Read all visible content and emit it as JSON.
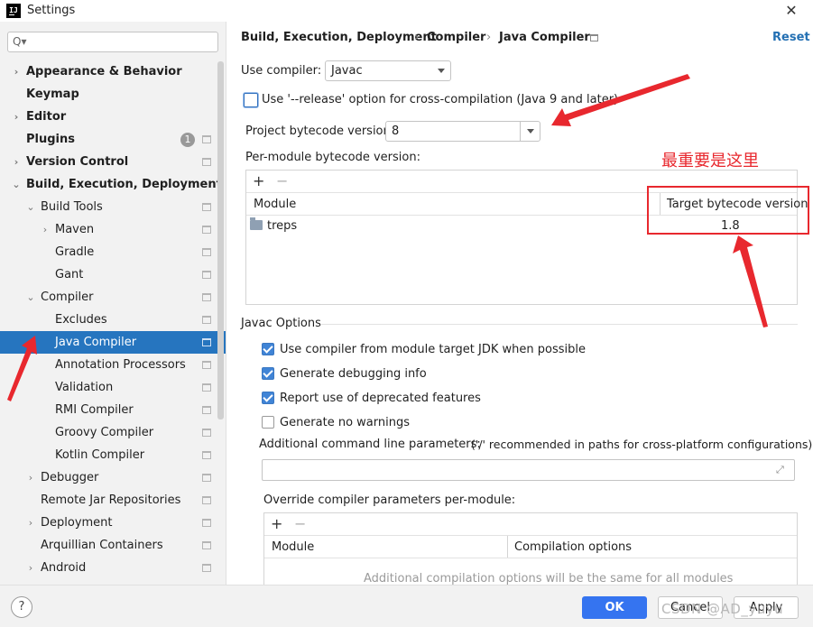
{
  "window": {
    "title": "Settings",
    "app_icon_text": "IJ",
    "close_glyph": "✕"
  },
  "sidebar": {
    "search_placeholder": "",
    "search_glyph": "Q▾",
    "items": [
      {
        "label": "Appearance & Behavior",
        "bold": true,
        "chevron": "›"
      },
      {
        "label": "Keymap",
        "bold": true
      },
      {
        "label": "Editor",
        "bold": true,
        "chevron": "›"
      },
      {
        "label": "Plugins",
        "bold": true,
        "badge": "1"
      },
      {
        "label": "Version Control",
        "bold": true,
        "chevron": "›"
      },
      {
        "label": "Build, Execution, Deployment",
        "bold": true,
        "chevron": "⌄"
      },
      {
        "label": "Build Tools",
        "chevron": "⌄"
      },
      {
        "label": "Maven",
        "chevron": "›"
      },
      {
        "label": "Gradle"
      },
      {
        "label": "Gant"
      },
      {
        "label": "Compiler",
        "chevron": "⌄"
      },
      {
        "label": "Excludes"
      },
      {
        "label": "Java Compiler",
        "selected": true
      },
      {
        "label": "Annotation Processors"
      },
      {
        "label": "Validation"
      },
      {
        "label": "RMI Compiler"
      },
      {
        "label": "Groovy Compiler"
      },
      {
        "label": "Kotlin Compiler"
      },
      {
        "label": "Debugger",
        "chevron": "›"
      },
      {
        "label": "Remote Jar Repositories"
      },
      {
        "label": "Deployment",
        "chevron": "›"
      },
      {
        "label": "Arquillian Containers"
      },
      {
        "label": "Android",
        "chevron": "›"
      }
    ]
  },
  "breadcrumb": {
    "items": [
      "Build, Execution, Deployment",
      "Compiler",
      "Java Compiler"
    ],
    "separator": "›",
    "reset_label": "Reset"
  },
  "main": {
    "use_compiler_label": "Use compiler:",
    "use_compiler_value": "Javac",
    "release_option_label": "Use '--release' option for cross-compilation (Java 9 and later)",
    "release_option_checked": false,
    "project_bytecode_label": "Project bytecode version:",
    "project_bytecode_value": "8",
    "per_module_label": "Per-module bytecode version:",
    "module_table": {
      "add": "+",
      "remove": "−",
      "columns": [
        "Module",
        "Target bytecode version"
      ],
      "rows": [
        {
          "module": "treps",
          "target": "1.8"
        }
      ]
    },
    "annotation_text": "最重要是这里",
    "javac_options_title": "Javac Options",
    "javac_options": [
      {
        "label": "Use compiler from module target JDK when possible",
        "checked": true
      },
      {
        "label": "Generate debugging info",
        "checked": true
      },
      {
        "label": "Report use of deprecated features",
        "checked": true
      },
      {
        "label": "Generate no warnings",
        "checked": false
      }
    ],
    "additional_params_label": "Additional command line parameters:",
    "additional_params_hint": "('/' recommended in paths for cross-platform configurations)",
    "additional_params_value": "",
    "expand_glyph": "⤢",
    "override_label": "Override compiler parameters per-module:",
    "override_table": {
      "add": "+",
      "remove": "−",
      "columns": [
        "Module",
        "Compilation options"
      ],
      "empty_text": "Additional compilation options will be the same for all modules"
    }
  },
  "footer": {
    "help_label": "?",
    "ok_label": "OK",
    "cancel_label": "Cancel",
    "apply_label": "Apply",
    "watermark": "CSDN @AD_yuyu"
  },
  "colors": {
    "selection": "#2675bf",
    "accent": "#3574f0",
    "annotation": "#e8282e"
  }
}
